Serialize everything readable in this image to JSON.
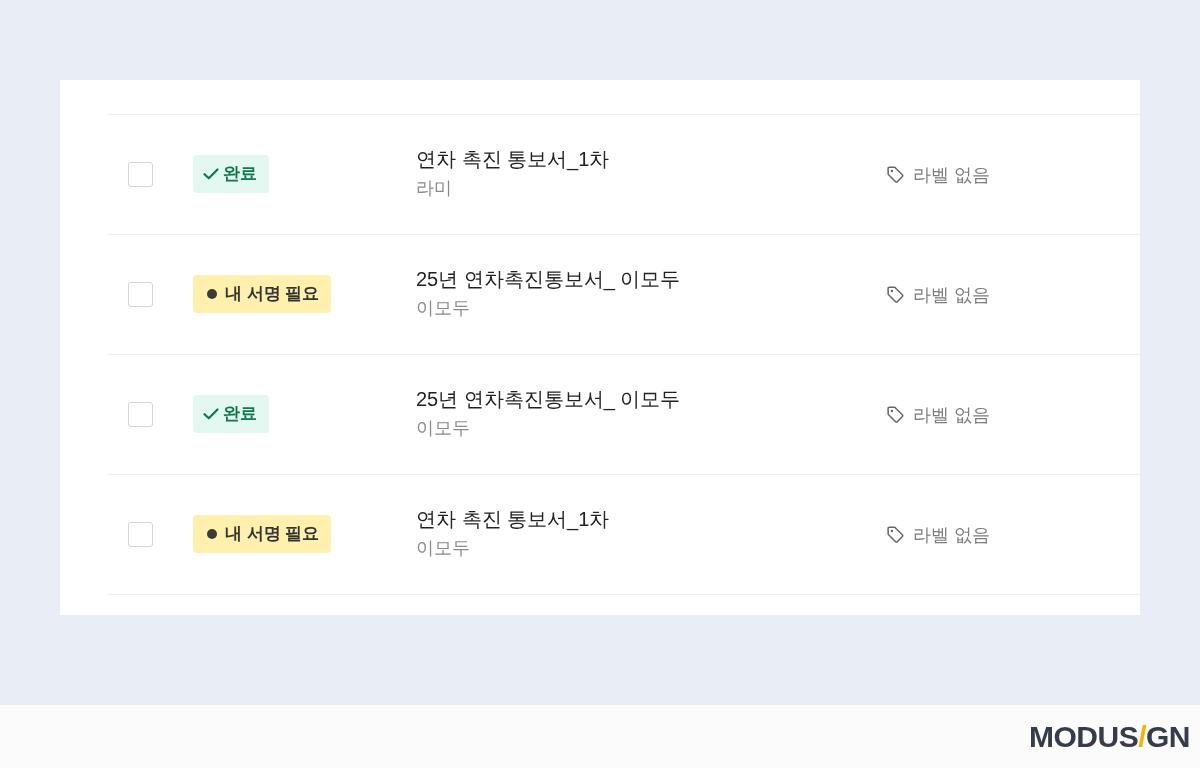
{
  "list": {
    "rows": [
      {
        "checked": false,
        "status": {
          "kind": "done",
          "label": "완료"
        },
        "title": "연차 촉진 통보서_1차",
        "subtitle": "라미",
        "label": "라벨 없음"
      },
      {
        "checked": false,
        "status": {
          "kind": "needs_signature",
          "label": "내 서명 필요"
        },
        "title": "25년 연차촉진통보서_ 이모두",
        "subtitle": "이모두",
        "label": "라벨 없음"
      },
      {
        "checked": false,
        "status": {
          "kind": "done",
          "label": "완료"
        },
        "title": "25년 연차촉진통보서_ 이모두",
        "subtitle": "이모두",
        "label": "라벨 없음"
      },
      {
        "checked": false,
        "status": {
          "kind": "needs_signature",
          "label": "내 서명 필요"
        },
        "title": "연차 촉진 통보서_1차",
        "subtitle": "이모두",
        "label": "라벨 없음"
      }
    ]
  },
  "footer": {
    "logo": {
      "before": "MODUS",
      "accent": "/",
      "after": "GN"
    }
  }
}
